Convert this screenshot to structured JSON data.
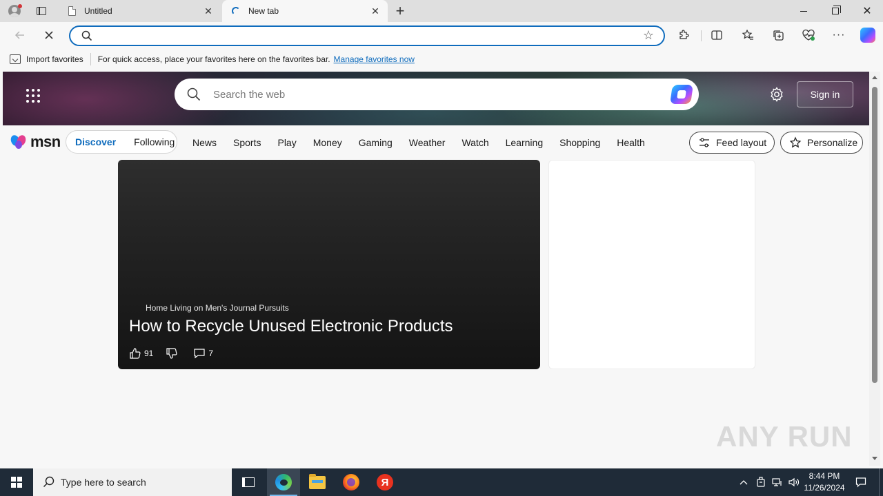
{
  "browser": {
    "tabs": [
      {
        "title": "Untitled",
        "active": false
      },
      {
        "title": "New tab",
        "active": true
      }
    ],
    "address_bar": {
      "value": "",
      "placeholder": ""
    }
  },
  "favorites_bar": {
    "import_label": "Import favorites",
    "hint_text": "For quick access, place your favorites here on the favorites bar.",
    "manage_link": "Manage favorites now"
  },
  "msn": {
    "search_placeholder": "Search the web",
    "sign_in": "Sign in",
    "logo_text": "msn",
    "feed_tabs": [
      {
        "label": "Discover",
        "selected": true
      },
      {
        "label": "Following",
        "selected": false
      }
    ],
    "categories": [
      "News",
      "Sports",
      "Play",
      "Money",
      "Gaming",
      "Weather",
      "Watch",
      "Learning",
      "Shopping",
      "Health"
    ],
    "feed_layout_label": "Feed layout",
    "personalize_label": "Personalize"
  },
  "card": {
    "source": "Home Living on Men's Journal Pursuits",
    "headline": "How to Recycle Unused Electronic Products",
    "likes": "91",
    "comments": "7"
  },
  "watermark": "ANY RUN",
  "taskbar": {
    "search_placeholder": "Type here to search",
    "time": "8:44 PM",
    "date": "11/26/2024",
    "apps": [
      "task-view",
      "microsoft-edge",
      "file-explorer",
      "firefox",
      "yandex-browser"
    ]
  },
  "colors": {
    "accent": "#0f6cbd",
    "taskbar": "#1f2b38",
    "card_bg": "#1e1e1e"
  }
}
